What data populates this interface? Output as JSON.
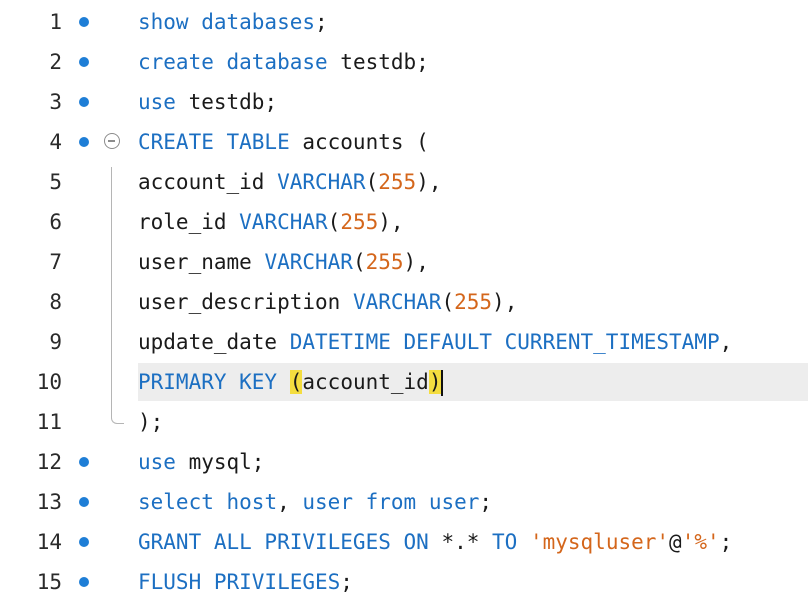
{
  "editor": {
    "lines": [
      {
        "num": "1",
        "breakpoint": true,
        "tokens": [
          [
            "k",
            "show databases"
          ],
          [
            "p",
            ";"
          ]
        ]
      },
      {
        "num": "2",
        "breakpoint": true,
        "tokens": [
          [
            "k",
            "create database"
          ],
          [
            "p",
            " testdb;"
          ]
        ]
      },
      {
        "num": "3",
        "breakpoint": true,
        "tokens": [
          [
            "k",
            "use"
          ],
          [
            "p",
            " testdb;"
          ]
        ]
      },
      {
        "num": "4",
        "breakpoint": true,
        "fold": "start",
        "tokens": [
          [
            "k",
            "CREATE TABLE"
          ],
          [
            "p",
            " accounts ("
          ]
        ]
      },
      {
        "num": "5",
        "breakpoint": false,
        "tokens": [
          [
            "p",
            "account_id "
          ],
          [
            "k",
            "VARCHAR"
          ],
          [
            "p",
            "("
          ],
          [
            "n",
            "255"
          ],
          [
            "p",
            "),"
          ]
        ]
      },
      {
        "num": "6",
        "breakpoint": false,
        "tokens": [
          [
            "p",
            "role_id "
          ],
          [
            "k",
            "VARCHAR"
          ],
          [
            "p",
            "("
          ],
          [
            "n",
            "255"
          ],
          [
            "p",
            "),"
          ]
        ]
      },
      {
        "num": "7",
        "breakpoint": false,
        "tokens": [
          [
            "p",
            "user_name "
          ],
          [
            "k",
            "VARCHAR"
          ],
          [
            "p",
            "("
          ],
          [
            "n",
            "255"
          ],
          [
            "p",
            "),"
          ]
        ]
      },
      {
        "num": "8",
        "breakpoint": false,
        "tokens": [
          [
            "p",
            "user_description "
          ],
          [
            "k",
            "VARCHAR"
          ],
          [
            "p",
            "("
          ],
          [
            "n",
            "255"
          ],
          [
            "p",
            "),"
          ]
        ]
      },
      {
        "num": "9",
        "breakpoint": false,
        "tokens": [
          [
            "p",
            "update_date "
          ],
          [
            "k",
            "DATETIME DEFAULT CURRENT_TIMESTAMP"
          ],
          [
            "p",
            ","
          ]
        ]
      },
      {
        "num": "10",
        "breakpoint": false,
        "current": true,
        "tokens": [
          [
            "k",
            "PRIMARY KEY"
          ],
          [
            "p",
            " "
          ],
          [
            "p hl",
            "("
          ],
          [
            "p",
            "account_id"
          ],
          [
            "p hl",
            ")"
          ],
          [
            "cursor",
            ""
          ]
        ]
      },
      {
        "num": "11",
        "breakpoint": false,
        "fold": "end",
        "tokens": [
          [
            "p",
            ");"
          ]
        ]
      },
      {
        "num": "12",
        "breakpoint": true,
        "tokens": [
          [
            "k",
            "use"
          ],
          [
            "p",
            " mysql;"
          ]
        ]
      },
      {
        "num": "13",
        "breakpoint": true,
        "tokens": [
          [
            "k",
            "select"
          ],
          [
            "p",
            " "
          ],
          [
            "k",
            "host"
          ],
          [
            "p",
            ", "
          ],
          [
            "k",
            "user from user"
          ],
          [
            "p",
            ";"
          ]
        ]
      },
      {
        "num": "14",
        "breakpoint": true,
        "tokens": [
          [
            "k",
            "GRANT ALL PRIVILEGES ON"
          ],
          [
            "p",
            " *.* "
          ],
          [
            "k",
            "TO"
          ],
          [
            "p",
            " "
          ],
          [
            "s",
            "'mysqluser'"
          ],
          [
            "p",
            "@"
          ],
          [
            "s",
            "'%'"
          ],
          [
            "p",
            ";"
          ]
        ]
      },
      {
        "num": "15",
        "breakpoint": true,
        "tokens": [
          [
            "k",
            "FLUSH PRIVILEGES"
          ],
          [
            "p",
            ";"
          ]
        ]
      }
    ]
  },
  "colors": {
    "keyword": "#1c6fc2",
    "number_string": "#d4661b",
    "bracket_highlight": "#f4dd3f",
    "current_line": "#ededed",
    "breakpoint_dot": "#1e7ed6"
  }
}
